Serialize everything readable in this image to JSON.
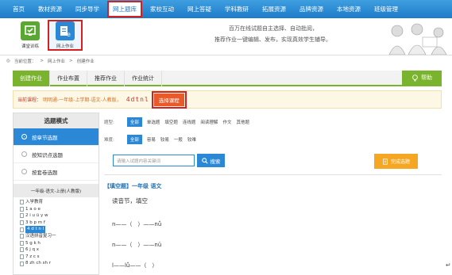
{
  "nav": {
    "items": [
      "首页",
      "教材资源",
      "同步导学",
      "网上题库",
      "家校互动",
      "网上答疑",
      "学科教研",
      "拓展资源",
      "品牌资源",
      "本地资源",
      "班级管理"
    ],
    "active_index": 3
  },
  "banner": {
    "apps": [
      {
        "label": "课堂训练",
        "icon": "practice-icon",
        "color": "#5aa832"
      },
      {
        "label": "网上作业",
        "icon": "online-homework-icon",
        "color": "#2b88d6"
      }
    ],
    "slogan_line1": "百万在线试题自主选择、自动批阅，",
    "slogan_line2": "推荐作业一键编辑、发布，实现真效学生辅导。"
  },
  "breadcrumb": {
    "prefix": "当前位置：",
    "items": [
      "网上作业",
      "创建作业"
    ],
    "separator": ">"
  },
  "tabs": {
    "items": [
      "创建作业",
      "作业布置",
      "推荐作业",
      "作业统计"
    ],
    "active_index": 0,
    "help_label": "帮助"
  },
  "course": {
    "label": "当前课程：",
    "value": "明明通-一年级-上学期-语文-人教版，",
    "symbols": "4dtnl",
    "choose_label": "选择课程"
  },
  "left_panel": {
    "title": "选题模式",
    "modes": [
      "按章节选题",
      "按知识点选题",
      "按套卷选题"
    ],
    "active_mode": 0,
    "book_title": "一年级-语文-上册(人教版)",
    "tree": [
      "入学教育",
      "1 a o e",
      "2 i u ü y w",
      "3 b p m f",
      "4 d t n l",
      "汉语拼音复习一",
      "5 g k h",
      "6 j q x",
      "7 z c s",
      "8 zh ch sh r"
    ],
    "selected_index": 4
  },
  "filters": {
    "type_label": "题型:",
    "types": [
      "全部",
      "单选题",
      "填空题",
      "连线题",
      "阅读理解",
      "作文",
      "其他题"
    ],
    "difficulty_label": "难度:",
    "difficulties": [
      "全部",
      "容易",
      "较易",
      "一般",
      "较难"
    ]
  },
  "search": {
    "placeholder": "请输入试题内容关键词",
    "button_label": "搜索",
    "finish_label": "完成选题"
  },
  "question": {
    "tag": "【填空题】一年级 语文",
    "text": "读音节，填空",
    "lines": [
      "n——（　）——nǚ",
      "n——（　）——nü",
      "l——lǚ——（　）"
    ]
  },
  "colors": {
    "nav": "#1d7bc8",
    "green": "#7ab32e",
    "blue": "#2b88d6",
    "orange": "#f5a623",
    "highlight": "#d42020"
  }
}
